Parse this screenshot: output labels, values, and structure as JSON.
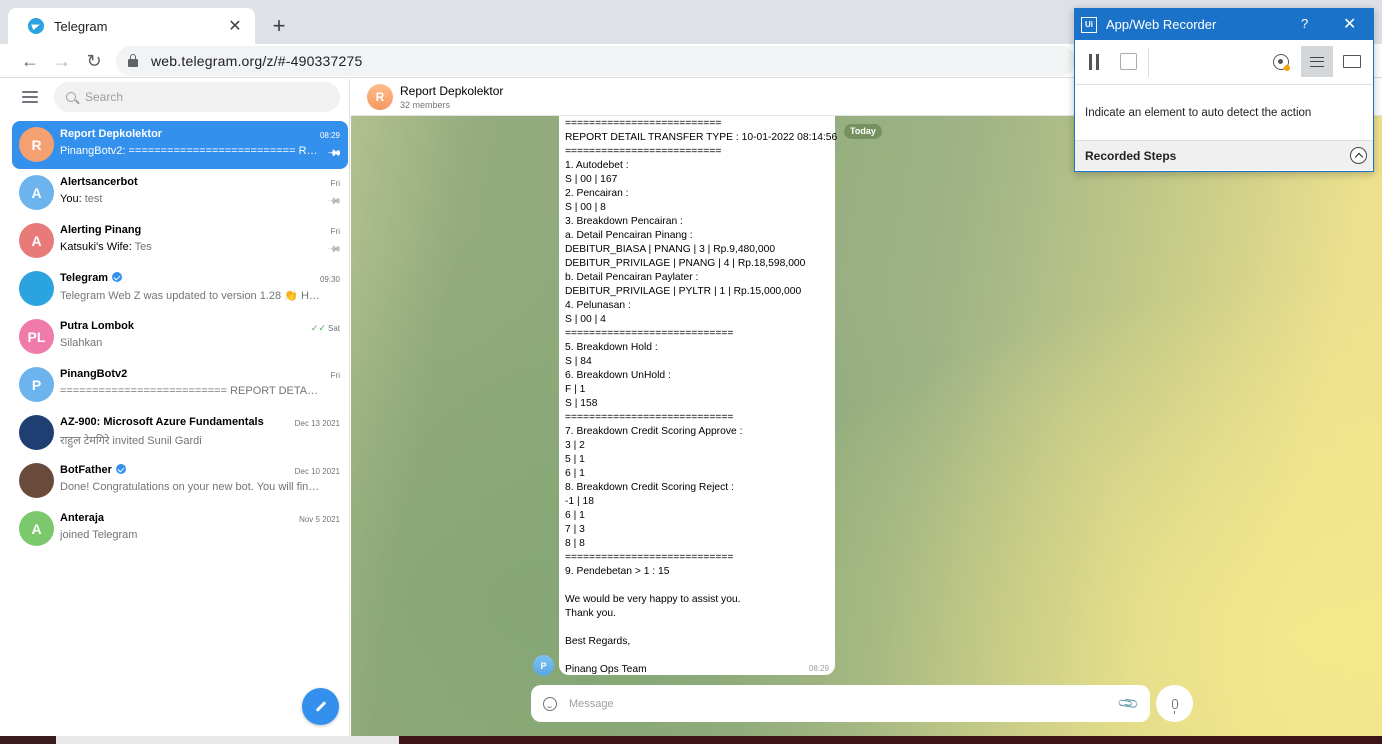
{
  "browser": {
    "tab_title": "Telegram",
    "url": "web.telegram.org/z/#-490337275"
  },
  "sidebar": {
    "search_placeholder": "Search",
    "chats": [
      {
        "initials": "R",
        "title": "Report Depkolektor",
        "sender": "PinangBotv2: ",
        "preview": "========================== REPOR…",
        "time": "08:29",
        "pinned": true,
        "active": true,
        "color": "#f5a070"
      },
      {
        "initials": "A",
        "title": "Alertsancerbot",
        "sender": "You: ",
        "preview": "test",
        "time": "Fri",
        "pinned": true,
        "color": "#6db4ef"
      },
      {
        "initials": "A",
        "title": "Alerting Pinang",
        "sender": "Katsuki's Wife: ",
        "preview": "Tes",
        "time": "Fri",
        "pinned": true,
        "color": "#e87a7a"
      },
      {
        "initials": "",
        "title": "Telegram",
        "sender": "",
        "preview": "Telegram Web Z was updated to version 1.28 👏 Harder •…",
        "time": "09:30",
        "verified": true,
        "color": "#2aa3df"
      },
      {
        "initials": "PL",
        "title": "Putra Lombok",
        "sender": "",
        "preview": "Silahkan",
        "time": "Sat",
        "ticks": "✓✓",
        "color": "#f07bab"
      },
      {
        "initials": "P",
        "title": "PinangBotv2",
        "sender": "",
        "preview": "========================== REPORT DETAIL TRANS…",
        "time": "Fri",
        "color": "#6db4ef"
      },
      {
        "initials": "",
        "title": "AZ-900: Microsoft Azure Fundamentals",
        "sender": "",
        "preview": "राहुल टेमगिरे invited Sunil Gardi",
        "time": "Dec 13 2021",
        "color": "#1f3f73"
      },
      {
        "initials": "",
        "title": "BotFather",
        "sender": "",
        "preview": "Done! Congratulations on your new bot. You will find it at …",
        "time": "Dec 10 2021",
        "verified": true,
        "color": "#6a4a3a"
      },
      {
        "initials": "A",
        "title": "Anteraja",
        "sender": "",
        "preview": "joined Telegram",
        "time": "Nov 5 2021",
        "color": "#7cc96d"
      }
    ]
  },
  "chat": {
    "title": "Report Depkolektor",
    "subtitle": "32 members",
    "avatar_initial": "R",
    "date_badge": "Today",
    "sender_initial": "P",
    "message_lines": [
      "==========================",
      "REPORT DETAIL TRANSFER TYPE : 10-01-2022 08:14:56",
      "==========================",
      "1. Autodebet :",
      "S | 00 | 167",
      "2. Pencairan :",
      "S | 00 | 8",
      "3. Breakdown Pencairan :",
      "a. Detail Pencairan Pinang :",
      "DEBITUR_BIASA | PNANG | 3 | Rp.9,480,000",
      "DEBITUR_PRIVILAGE | PNANG | 4 | Rp.18,598,000",
      "b. Detail Pencairan Paylater :",
      "DEBITUR_PRIVILAGE | PYLTR | 1 | Rp.15,000,000",
      "4. Pelunasan :",
      "S | 00 | 4",
      "============================",
      "5. Breakdown Hold :",
      "S | 84",
      "6. Breakdown UnHold :",
      "F | 1",
      "S | 158",
      "============================",
      "7. Breakdown Credit Scoring Approve :",
      "3 | 2",
      "5 | 1",
      "6 | 1",
      "8. Breakdown Credit Scoring Reject :",
      "-1 | 18",
      "6 | 1",
      "7 | 3",
      "8 | 8",
      "============================",
      "9. Pendebetan > 1 : 15",
      "",
      "We would be very happy to assist you.",
      "Thank you.",
      "",
      "Best Regards,",
      "",
      "Pinang Ops Team"
    ],
    "message_time": "08:29",
    "composer_placeholder": "Message"
  },
  "recorder": {
    "title": "App/Web Recorder",
    "help": "?",
    "close": "✕",
    "logo": "Ui",
    "hint": "Indicate an element to auto detect the action",
    "steps_label": "Recorded Steps"
  }
}
